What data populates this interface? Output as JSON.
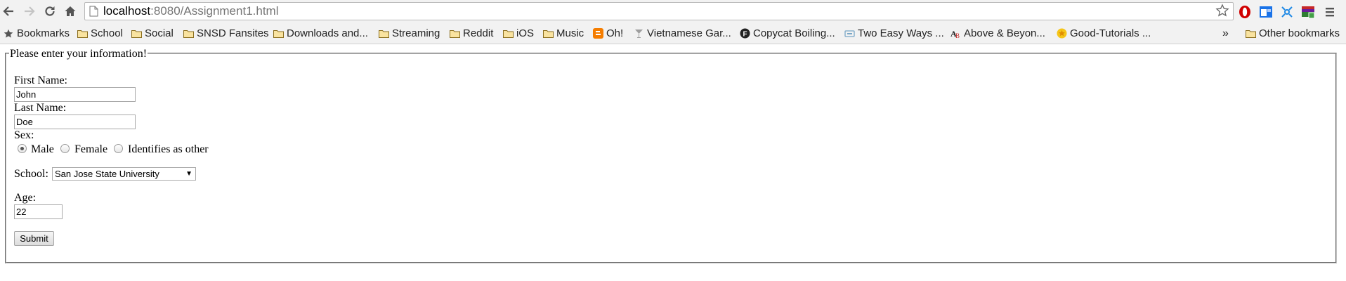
{
  "browser": {
    "url_host": "localhost",
    "url_path": ":8080/Assignment1.html",
    "icons": [
      "back-icon",
      "forward-icon",
      "reload-icon",
      "home-icon",
      "page-icon",
      "star-icon",
      "opera-icon",
      "extension-icon",
      "network-icon",
      "wallet-icon",
      "menu-icon"
    ]
  },
  "bookmarks": {
    "items": [
      "Bookmarks",
      "School",
      "Social",
      "SNSD Fansites",
      "Downloads and...",
      "Streaming",
      "Reddit",
      "iOS",
      "Music",
      "Oh!",
      "Vietnamese Gar...",
      "Copycat Boiling...",
      "Two Easy Ways ...",
      "Above & Beyon...",
      "Good-Tutorials ..."
    ],
    "overflow": "»",
    "other": "Other bookmarks"
  },
  "form": {
    "legend": "Please enter your information!",
    "first_name_label": "First Name:",
    "first_name_value": "John",
    "last_name_label": "Last Name:",
    "last_name_value": "Doe",
    "sex_label": "Sex:",
    "sex_options": [
      "Male",
      "Female",
      "Identifies as other"
    ],
    "sex_selected": "Male",
    "school_label": "School:",
    "school_value": "San Jose State University",
    "age_label": "Age:",
    "age_value": "22",
    "submit_label": "Submit"
  },
  "colors": {
    "toolbar_bg": "#f2f2f2",
    "url_path": "#757575",
    "blogger_orange": "#f57d00",
    "opera_red": "#d00000"
  }
}
